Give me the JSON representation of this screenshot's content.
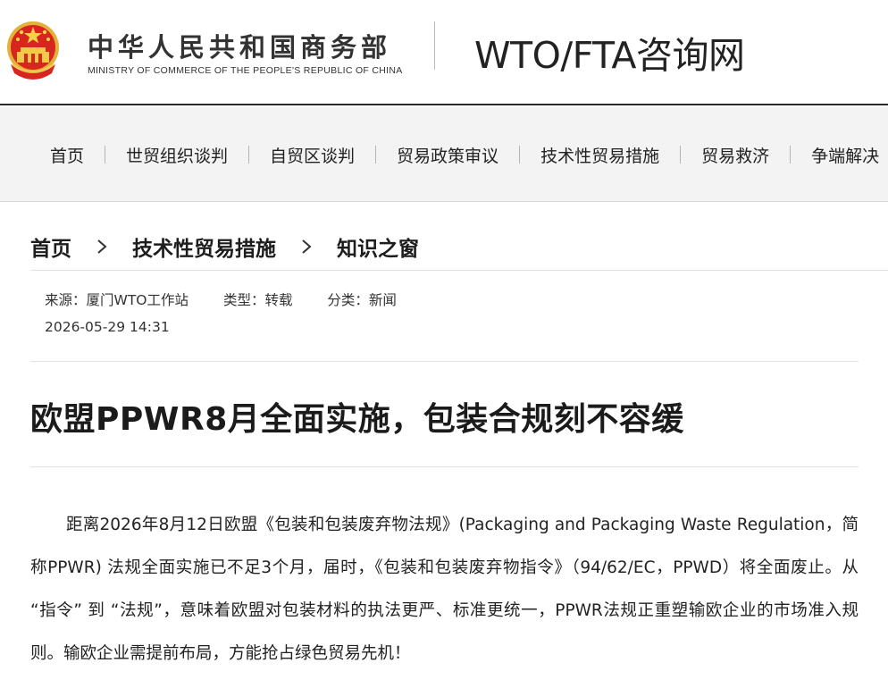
{
  "header": {
    "ministry_cn": "中华人民共和国商务部",
    "ministry_en": "MINISTRY OF COMMERCE OF THE PEOPLE'S REPUBLIC OF CHINA",
    "site_title": "WTO/FTA咨询网"
  },
  "nav": {
    "items": [
      "首页",
      "世贸组织谈判",
      "自贸区谈判",
      "贸易政策审议",
      "技术性贸易措施",
      "贸易救济",
      "争端解决"
    ]
  },
  "breadcrumb": {
    "items": [
      "首页",
      "技术性贸易措施",
      "知识之窗"
    ]
  },
  "meta": {
    "source": "来源：厦门WTO工作站",
    "type": "类型：转载",
    "category": "分类：新闻",
    "datetime": "2026-05-29 14:31"
  },
  "article": {
    "title": "欧盟PPWR8月全面实施，包装合规刻不容缓",
    "paragraph": "距离2026年8月12日欧盟《包装和包装废弃物法规》(Packaging and Packaging Waste Regulation，简称PPWR) 法规全面实施已不足3个月，届时，《包装和包装废弃物指令》（94/62/EC，PPWD）将全面废止。从 “指令” 到 “法规”，意味着欧盟对包装材料的执法更严、标准更统一，PPWR法规正重塑输欧企业的市场准入规则。输欧企业需提前布局，方能抢占绿色贸易先机！"
  },
  "colors": {
    "emblem_red": "#d7261e",
    "emblem_gold": "#f5c542",
    "header_rule": "#2b2b2b",
    "nav_bg": "#f3f3f3"
  }
}
